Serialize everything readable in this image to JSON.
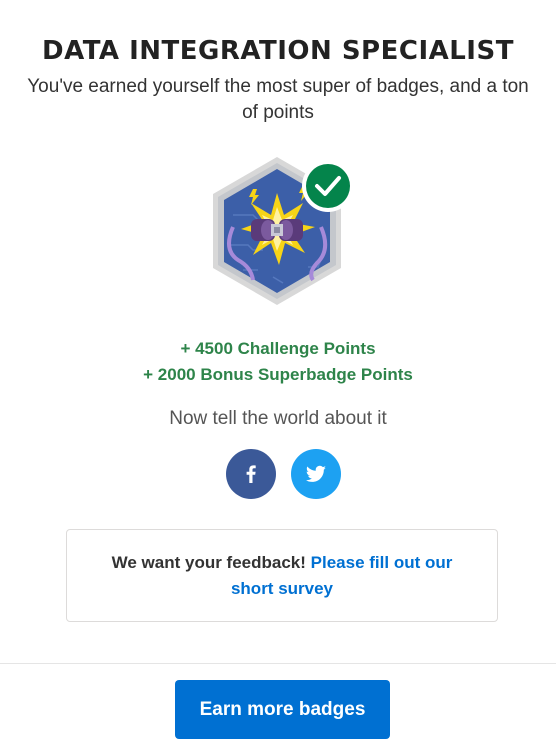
{
  "header": {
    "title": "DATA INTEGRATION SPECIALIST",
    "subtitle": "You've earned yourself the most super of badges, and a ton of points"
  },
  "badge": {
    "icon": "data-integration-superbadge-icon",
    "status_icon": "checkmark-icon",
    "colors": {
      "hex_outer": "#d8d8d8",
      "hex_inner": "#3c5fa8",
      "check_bg": "#04844b"
    }
  },
  "points": {
    "challenge": "+ 4500 Challenge Points",
    "bonus": "+ 2000 Bonus Superbadge Points"
  },
  "share": {
    "prompt": "Now tell the world about it",
    "facebook_icon": "facebook-icon",
    "twitter_icon": "twitter-icon"
  },
  "feedback": {
    "lead": "We want your feedback!",
    "link": "Please fill out our short survey"
  },
  "footer": {
    "button_label": "Earn more badges"
  },
  "colors": {
    "accent": "#0070d2",
    "points_green": "#2e844a",
    "facebook": "#3b5998",
    "twitter": "#1da1f2"
  }
}
